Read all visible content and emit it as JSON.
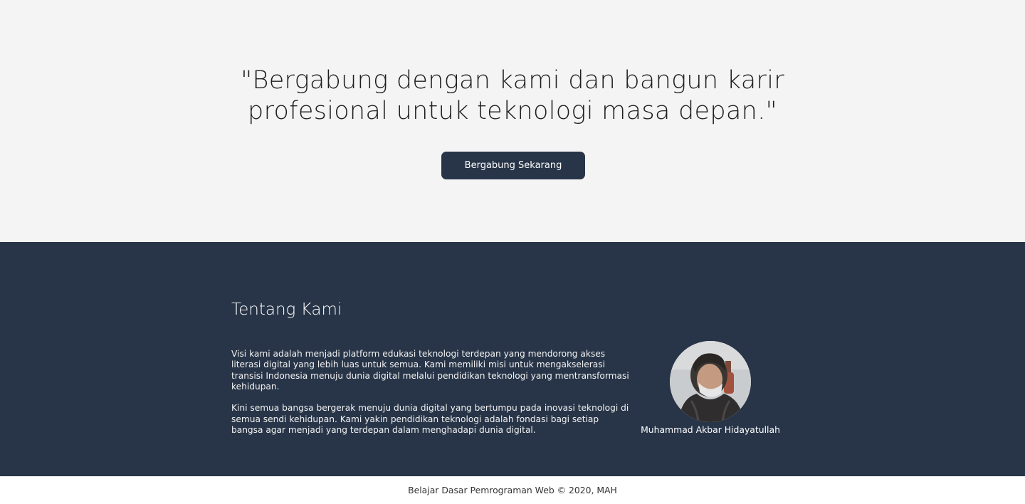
{
  "hero": {
    "quote_line1": "\"Bergabung dengan kami dan bangun karir",
    "quote_line2": "profesional untuk teknologi masa depan.\"",
    "button_label": "Bergabung Sekarang"
  },
  "about": {
    "title": "Tentang Kami",
    "paragraph1": "Visi kami adalah menjadi platform edukasi teknologi terdepan yang mendorong akses literasi digital yang lebih luas untuk semua. Kami memiliki misi untuk mengakselerasi transisi Indonesia menuju dunia digital melalui pendidikan teknologi yang mentransformasi kehidupan.",
    "paragraph2": "Kini semua bangsa bergerak menuju dunia digital yang bertumpu pada inovasi teknologi di semua sendi kehidupan. Kami yakin pendidikan teknologi adalah fondasi bagi setiap bangsa agar menjadi yang terdepan dalam menghadapi dunia digital.",
    "profile_name": "Muhammad Akbar Hidayatullah"
  },
  "footer": {
    "text": "Belajar Dasar Pemrograman Web © 2020, MAH"
  },
  "colors": {
    "hero_background": "#f4f4f4",
    "accent_dark": "#283548",
    "footer_background": "#ffffff"
  }
}
